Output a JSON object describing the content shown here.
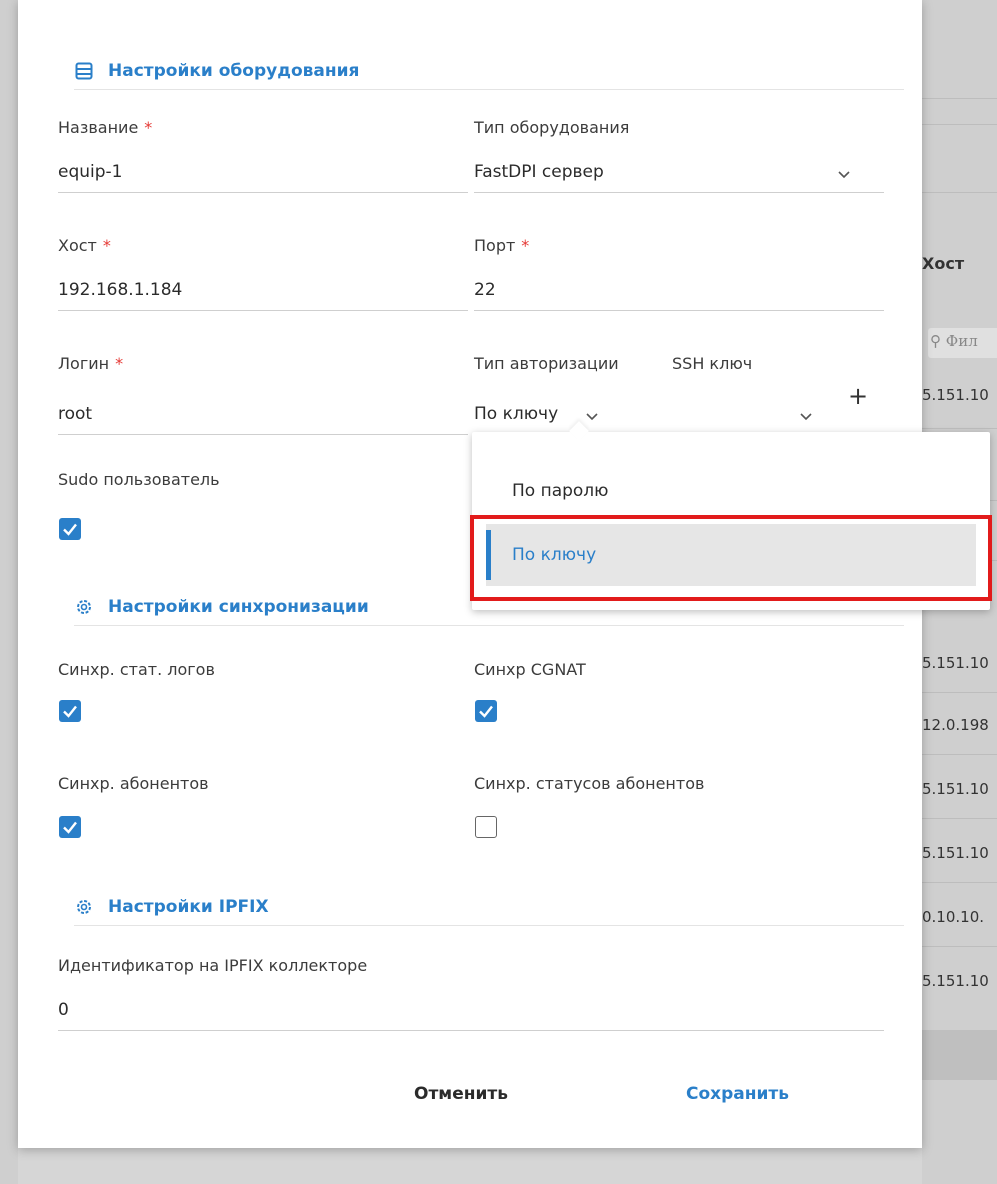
{
  "background": {
    "right_header": "Хост",
    "right_filter_placeholder": "Фил",
    "right_cells": [
      "5.151.10",
      "5.151.10",
      "12.0.198",
      "5.151.10",
      "5.151.10",
      "0.10.10.",
      "5.151.10"
    ]
  },
  "sections": {
    "equipment": {
      "title": "Настройки оборудования",
      "icon": "table-list-icon"
    },
    "sync": {
      "title": "Настройки синхронизации",
      "icon": "gear-icon"
    },
    "ipfix": {
      "title": "Настройки IPFIX",
      "icon": "gear-icon"
    }
  },
  "fields": {
    "name": {
      "label": "Название",
      "required_mark": "*",
      "value": "equip-1"
    },
    "equipment_type": {
      "label": "Тип оборудования",
      "value": "FastDPI сервер"
    },
    "host": {
      "label": "Хост",
      "required_mark": "*",
      "value": "192.168.1.184"
    },
    "port": {
      "label": "Порт",
      "required_mark": "*",
      "value": "22"
    },
    "login": {
      "label": "Логин",
      "required_mark": "*",
      "value": "root"
    },
    "auth_type": {
      "label": "Тип авторизации",
      "value": "По ключу"
    },
    "ssh_key": {
      "label": "SSH ключ",
      "value": ""
    },
    "sudo_user": {
      "label": "Sudo пользователь",
      "checked": true
    },
    "sync_stat_logs": {
      "label": "Синхр. стат. логов",
      "checked": true
    },
    "sync_cgnat": {
      "label": "Синхр CGNAT",
      "checked": true
    },
    "sync_subscribers": {
      "label": "Синхр. абонентов",
      "checked": true
    },
    "sync_subscriber_statuses": {
      "label": "Синхр. статусов абонентов",
      "checked": false
    },
    "ipfix_id": {
      "label": "Идентификатор на IPFIX коллекторе",
      "value": "0"
    }
  },
  "dropdown": {
    "options": [
      "По паролю",
      "По ключу"
    ],
    "selected": "По ключу"
  },
  "actions": {
    "cancel_label": "Отменить",
    "save_label": "Сохранить"
  },
  "colors": {
    "accent": "#2a7fc9",
    "required": "#e53935",
    "highlight": "#e21b1b"
  }
}
